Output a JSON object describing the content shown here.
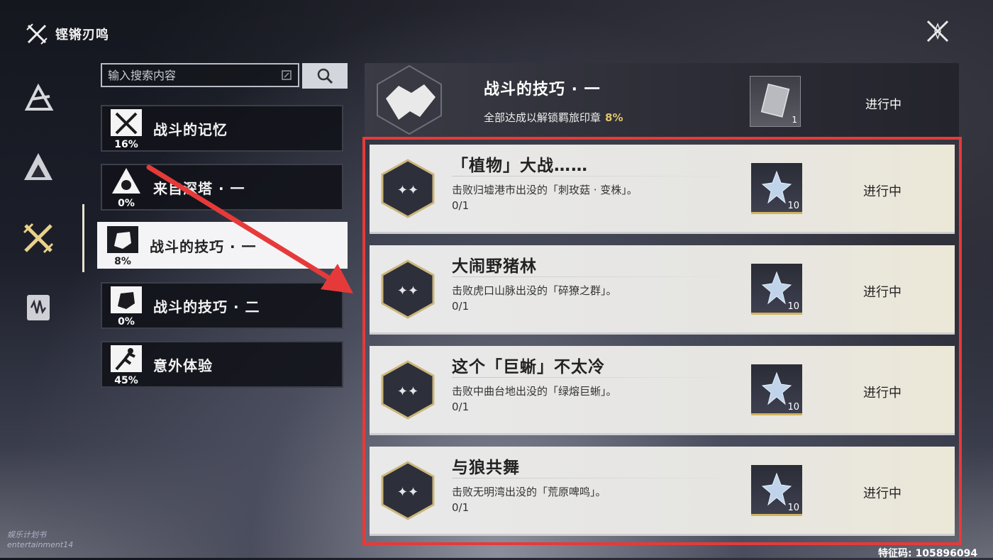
{
  "header": {
    "app_title": "铿锵刃鸣",
    "close_icon": "close-x-icon"
  },
  "rail": {
    "items": [
      {
        "name": "rail-icon-a",
        "icon": "triangle-emblem-icon"
      },
      {
        "name": "rail-icon-peak",
        "icon": "peak-emblem-icon"
      },
      {
        "name": "rail-icon-swords",
        "icon": "crossed-swords-icon",
        "active": true
      },
      {
        "name": "rail-icon-card",
        "icon": "card-wave-icon"
      }
    ]
  },
  "search": {
    "placeholder": "输入搜索内容"
  },
  "categories": [
    {
      "label": "战斗的记忆",
      "pct": "16%",
      "icon": "crossed-swords-icon"
    },
    {
      "label": "来自深塔 · 一",
      "pct": "0%",
      "icon": "tower-icon"
    },
    {
      "label": "战斗的技巧 · 一",
      "pct": "8%",
      "icon": "fist-icon"
    },
    {
      "label": "战斗的技巧 · 二",
      "pct": "0%",
      "icon": "fist-icon"
    },
    {
      "label": "意外体验",
      "pct": "45%",
      "icon": "stumble-icon"
    }
  ],
  "main": {
    "title": "战斗的技巧 · 一",
    "subtitle": "全部达成以解锁羁旅印章",
    "subtitle_pct": "8%",
    "reward_count": "1",
    "status": "进行中"
  },
  "quests": [
    {
      "title": "「植物」大战……",
      "desc": "击败归墟港市出没的「刺玫菇 · 变株」。",
      "progress": "0/1",
      "reward_count": "10",
      "status": "进行中"
    },
    {
      "title": "大闹野猪林",
      "desc": "击败虎口山脉出没的「碎獠之群」。",
      "progress": "0/1",
      "reward_count": "10",
      "status": "进行中"
    },
    {
      "title": "这个「巨蜥」不太冷",
      "desc": "击败中曲台地出没的「绿熔巨蜥」。",
      "progress": "0/1",
      "reward_count": "10",
      "status": "进行中"
    },
    {
      "title": "与狼共舞",
      "desc": "击败无明湾出没的「荒原啤鸣」。",
      "progress": "0/1",
      "reward_count": "10",
      "status": "进行中"
    }
  ],
  "watermark": {
    "line1": "娱乐计划书",
    "line2": "entertainment14"
  },
  "corner_text": "特征码: 105896094",
  "colors": {
    "accent_gold": "#e2c46e",
    "highlight_red": "#e63a3a"
  }
}
